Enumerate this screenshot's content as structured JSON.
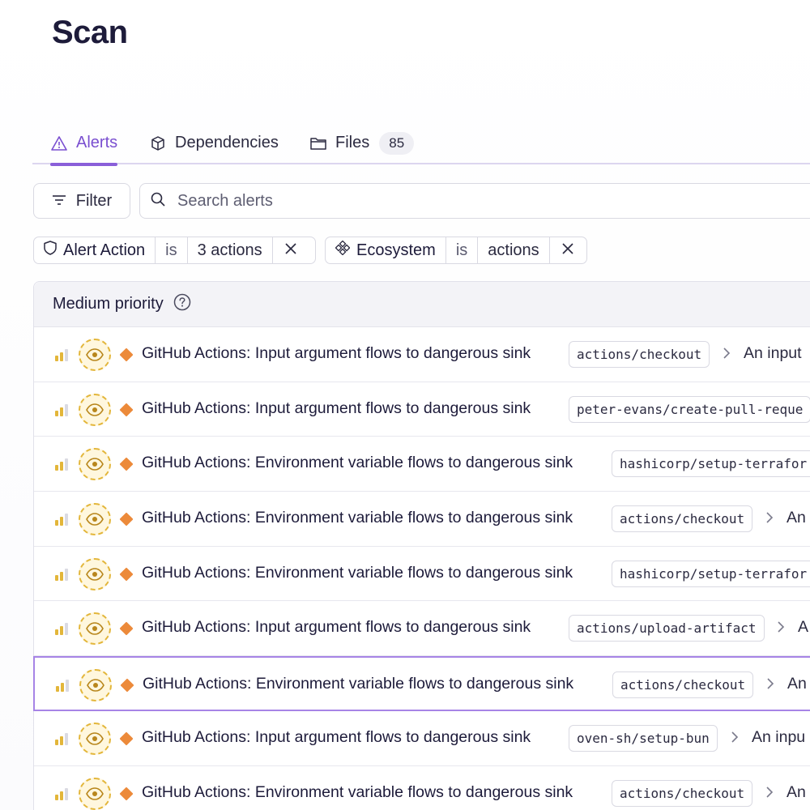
{
  "page": {
    "title": "Scan"
  },
  "tabs": [
    {
      "label": "Alerts",
      "icon": "warning-triangle-icon",
      "active": true
    },
    {
      "label": "Dependencies",
      "icon": "package-box-icon"
    },
    {
      "label": "Files",
      "icon": "folder-icon",
      "count": "85"
    }
  ],
  "toolbar": {
    "filter_label": "Filter",
    "search_placeholder": "Search alerts",
    "search_value": ""
  },
  "filters": [
    {
      "key": "Alert Action",
      "icon": "shield-icon",
      "operator": "is",
      "value": "3 actions"
    },
    {
      "key": "Ecosystem",
      "icon": "ecosystem-icon",
      "operator": "is",
      "value": "actions"
    }
  ],
  "group": {
    "label": "Medium priority",
    "help_icon": "question-circle-icon"
  },
  "alerts": [
    {
      "title": "GitHub Actions: Input argument flows to dangerous sink",
      "package": "actions/checkout",
      "description": "An input"
    },
    {
      "title": "GitHub Actions: Input argument flows to dangerous sink",
      "package": "peter-evans/create-pull-reque",
      "description": ""
    },
    {
      "title": "GitHub Actions: Environment variable flows to dangerous sink",
      "package": "hashicorp/setup-terrafor",
      "description": ""
    },
    {
      "title": "GitHub Actions: Environment variable flows to dangerous sink",
      "package": "actions/checkout",
      "description": "An"
    },
    {
      "title": "GitHub Actions: Environment variable flows to dangerous sink",
      "package": "hashicorp/setup-terrafor",
      "description": ""
    },
    {
      "title": "GitHub Actions: Input argument flows to dangerous sink",
      "package": "actions/upload-artifact",
      "description": "A"
    },
    {
      "title": "GitHub Actions: Environment variable flows to dangerous sink",
      "package": "actions/checkout",
      "description": "An",
      "selected": true
    },
    {
      "title": "GitHub Actions: Input argument flows to dangerous sink",
      "package": "oven-sh/setup-bun",
      "description": "An inpu"
    },
    {
      "title": "GitHub Actions: Environment variable flows to dangerous sink",
      "package": "actions/checkout",
      "description": "An"
    }
  ],
  "colors": {
    "accent": "#8a5fd9",
    "severity_medium": "#ec8a3a",
    "eye_badge": "#e3b63a",
    "signal_bars": "#e3b63a"
  },
  "icons": {
    "severity": "signal-bars-icon",
    "status": "eye-icon",
    "priority": "diamond-icon",
    "row_expand": "chevron-right-icon"
  }
}
